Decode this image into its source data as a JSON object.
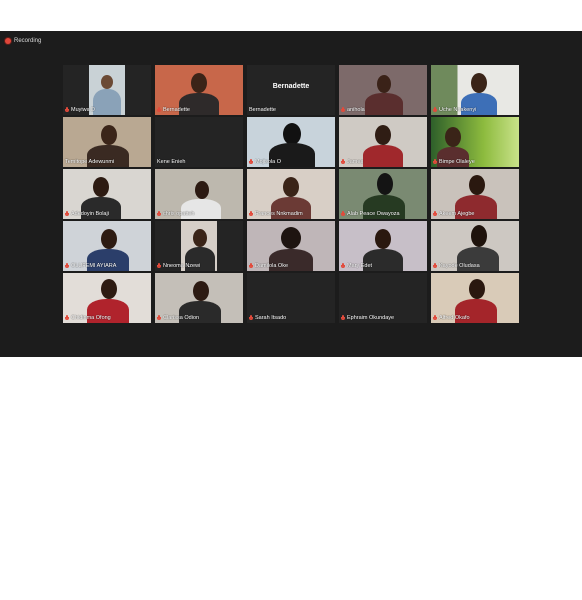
{
  "window": {
    "recording_label": "Recording"
  },
  "participants": [
    {
      "name": "Muyiwa D"
    },
    {
      "name": "Bernadette"
    },
    {
      "name": "Bernadette",
      "display_label": "Bernadette"
    },
    {
      "name": "anihola"
    },
    {
      "name": "Uche Nnakenyi"
    },
    {
      "name": "Temitope Adewunmi"
    },
    {
      "name": "Kene Enieh"
    },
    {
      "name": "Mojisola O"
    },
    {
      "name": "James"
    },
    {
      "name": "Bimpe Olaleye"
    },
    {
      "name": "Adedoyin Bolaji"
    },
    {
      "name": "chris opatteh"
    },
    {
      "name": "Frances Nnkmadim"
    },
    {
      "name": "Alab Peace Owayoza"
    },
    {
      "name": "Akeem Ajegbe"
    },
    {
      "name": "OLUFEMI AYIARA"
    },
    {
      "name": "Nneoma Nzewi"
    },
    {
      "name": "Damilola Oke"
    },
    {
      "name": "Mary Edet"
    },
    {
      "name": "Kayode Oludasa"
    },
    {
      "name": "Chidinma Ofong"
    },
    {
      "name": "Clarissa Odion"
    },
    {
      "name": "Sarah Itsado"
    },
    {
      "name": "Ephraim Okundaye"
    },
    {
      "name": "Alfred Okafo"
    }
  ],
  "active_speaker": "Temitope Adewunmi",
  "colors": {
    "active_border": "#c9d44a",
    "mic_muted": "#e24a3b",
    "window_bg": "#1c1c1c"
  }
}
